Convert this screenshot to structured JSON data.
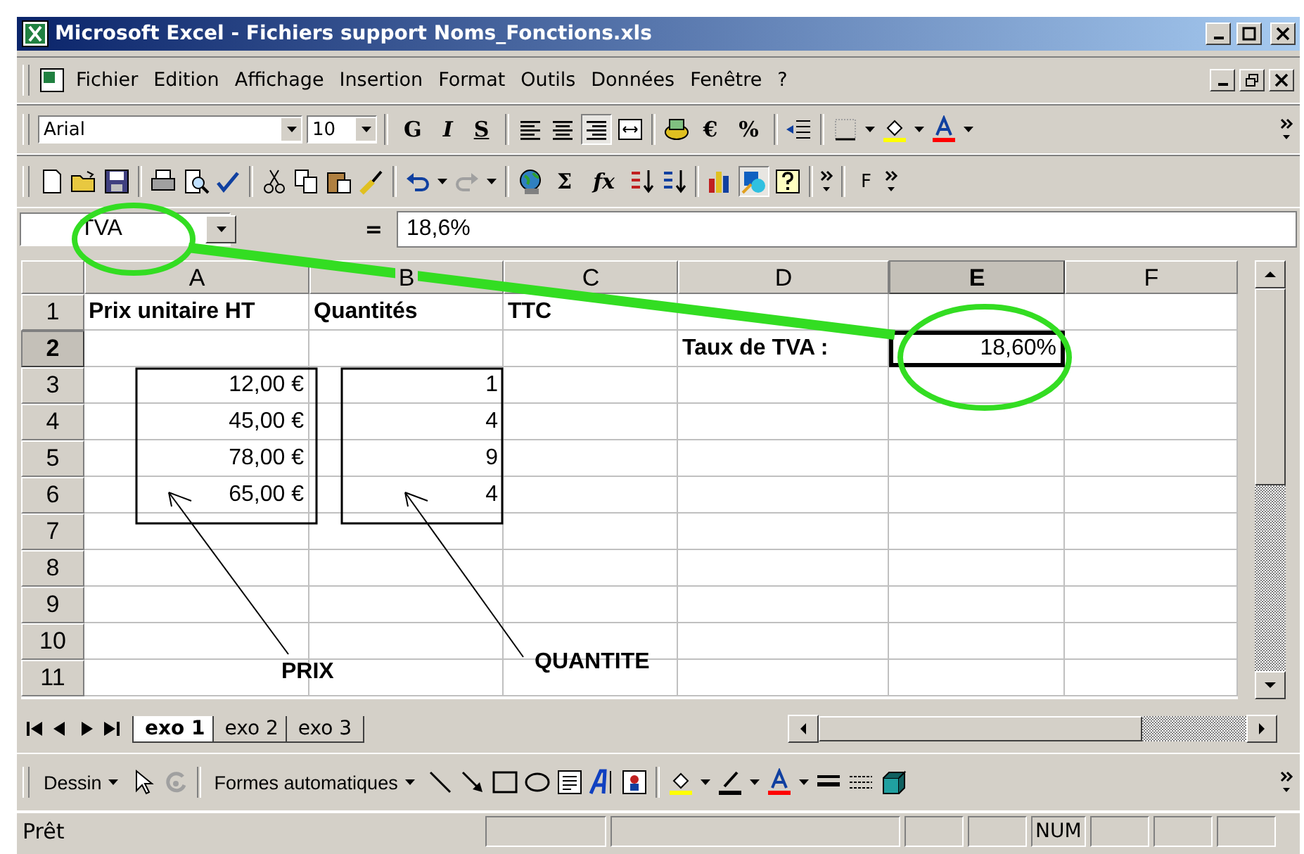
{
  "window": {
    "title": "Microsoft Excel - Fichiers support  Noms_Fonctions.xls"
  },
  "menu": [
    "Fichier",
    "Edition",
    "Affichage",
    "Insertion",
    "Format",
    "Outils",
    "Données",
    "Fenêtre",
    "?"
  ],
  "format_toolbar": {
    "font": "Arial",
    "size": "10",
    "bold": "G",
    "italic": "I",
    "underline": "S",
    "euro": "€",
    "percent": "%"
  },
  "standard_toolbar": {
    "sum": "Σ",
    "function": "fx",
    "overflow_label": "F"
  },
  "formula_bar": {
    "name_box": "TVA",
    "equals": "=",
    "content": "18,6%"
  },
  "columns": [
    {
      "label": "A",
      "selected": false
    },
    {
      "label": "B",
      "selected": false
    },
    {
      "label": "C",
      "selected": false
    },
    {
      "label": "D",
      "selected": false
    },
    {
      "label": "E",
      "selected": true
    },
    {
      "label": "F",
      "selected": false
    }
  ],
  "rows": [
    {
      "label": "1",
      "selected": false,
      "cells": {
        "A": {
          "text": "Prix unitaire HT",
          "kind": "heading"
        },
        "B": {
          "text": "Quantités",
          "kind": "heading"
        },
        "C": {
          "text": "TTC",
          "kind": "heading"
        }
      }
    },
    {
      "label": "2",
      "selected": true,
      "cells": {
        "D": {
          "text": "Taux de TVA :",
          "kind": "heading"
        },
        "E": {
          "text": "18,60%",
          "kind": "number"
        }
      }
    },
    {
      "label": "3",
      "selected": false,
      "cells": {
        "A": {
          "text": "12,00 €",
          "kind": "number"
        },
        "B": {
          "text": "1",
          "kind": "number"
        }
      }
    },
    {
      "label": "4",
      "selected": false,
      "cells": {
        "A": {
          "text": "45,00 €",
          "kind": "number"
        },
        "B": {
          "text": "4",
          "kind": "number"
        }
      }
    },
    {
      "label": "5",
      "selected": false,
      "cells": {
        "A": {
          "text": "78,00 €",
          "kind": "number"
        },
        "B": {
          "text": "9",
          "kind": "number"
        }
      }
    },
    {
      "label": "6",
      "selected": false,
      "cells": {
        "A": {
          "text": "65,00 €",
          "kind": "number"
        },
        "B": {
          "text": "4",
          "kind": "number"
        }
      }
    },
    {
      "label": "7",
      "selected": false,
      "cells": {}
    },
    {
      "label": "8",
      "selected": false,
      "cells": {}
    },
    {
      "label": "9",
      "selected": false,
      "cells": {}
    },
    {
      "label": "10",
      "selected": false,
      "cells": {}
    },
    {
      "label": "11",
      "selected": false,
      "cells": {}
    }
  ],
  "annotations": [
    {
      "text": "PRIX"
    },
    {
      "text": "QUANTITE"
    }
  ],
  "sheet_tabs": [
    {
      "label": "exo 1",
      "selected": true
    },
    {
      "label": "exo 2",
      "selected": false
    },
    {
      "label": "exo 3",
      "selected": false
    }
  ],
  "drawing_toolbar": {
    "draw_menu": "Dessin",
    "autoshapes": "Formes automatiques"
  },
  "status_bar": {
    "text": "Prêt",
    "indicators": [
      "NUM"
    ]
  }
}
